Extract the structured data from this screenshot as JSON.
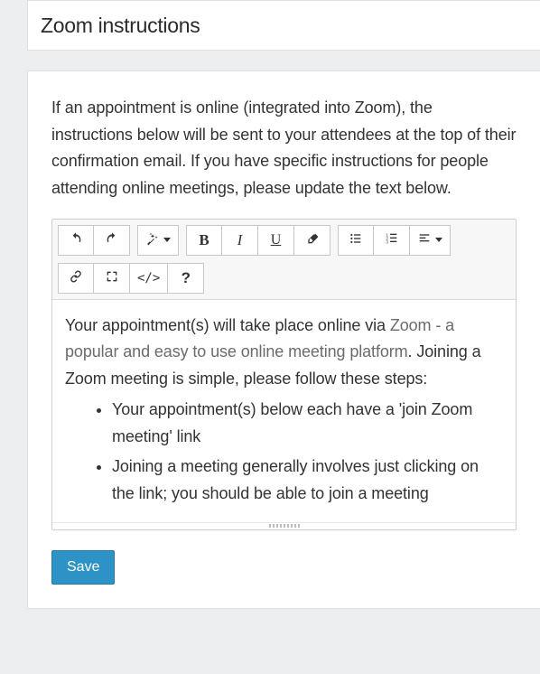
{
  "header": {
    "title": "Zoom instructions"
  },
  "intro": "If an appointment is online (integrated into Zoom), the instructions below will be sent to your attendees at the top of their confirmation email. If you have specific instructions for people attending online meetings, please update the text below.",
  "toolbar": {
    "bold": "B",
    "italic": "I",
    "underline": "U",
    "code": "</>",
    "help": "?"
  },
  "editor": {
    "p1_prefix": "Your appointment(s) will take place online via ",
    "p1_link": "Zoom - a popular and easy to use online meeting platform",
    "p1_suffix": ". Joining a Zoom meeting is simple, please follow these steps:",
    "bullets": [
      "Your appointment(s) below each have a 'join Zoom meeting' link",
      "Joining a meeting generally involves just clicking on the link; you should be able to join a meeting"
    ]
  },
  "actions": {
    "save": "Save"
  }
}
